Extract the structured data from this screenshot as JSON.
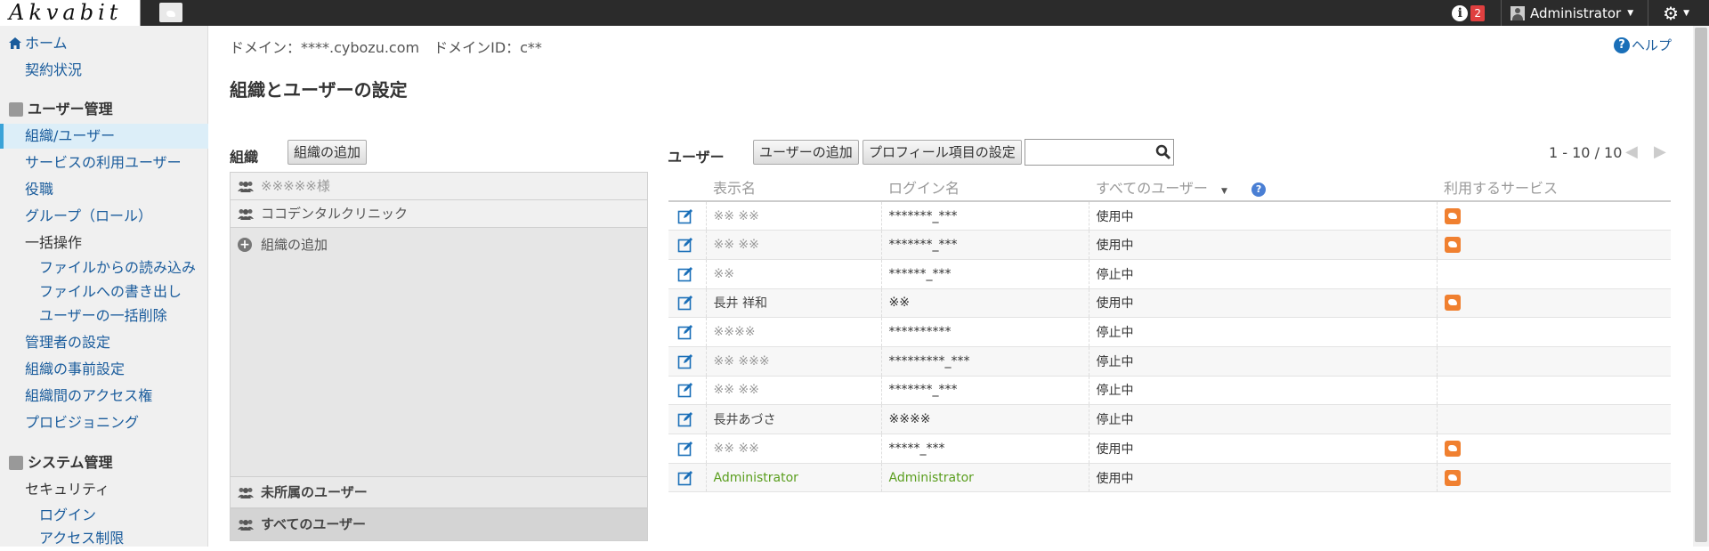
{
  "topbar": {
    "logo_text": "Akvabit",
    "notification_count": "2",
    "user_name": "Administrator"
  },
  "sidebar": {
    "home": "ホーム",
    "contract": "契約状況",
    "user_mgmt_head": "ユーザー管理",
    "items": [
      {
        "label": "組織/ユーザー"
      },
      {
        "label": "サービスの利用ユーザー"
      },
      {
        "label": "役職"
      },
      {
        "label": "グループ（ロール）"
      }
    ],
    "bulk": "一括操作",
    "bulk_items": [
      {
        "label": "ファイルからの読み込み"
      },
      {
        "label": "ファイルへの書き出し"
      },
      {
        "label": "ユーザーの一括削除"
      }
    ],
    "more_items": [
      {
        "label": "管理者の設定"
      },
      {
        "label": "組織の事前設定"
      },
      {
        "label": "組織間のアクセス権"
      },
      {
        "label": "プロビジョニング"
      }
    ],
    "system_head": "システム管理",
    "security": "セキュリティ",
    "security_items": [
      {
        "label": "ログイン"
      },
      {
        "label": "アクセス制限"
      }
    ]
  },
  "header": {
    "domain_text": "ドメイン：****.cybozu.com　ドメインID：c**",
    "help": "ヘルプ",
    "title": "組織とユーザーの設定"
  },
  "org": {
    "label": "組織",
    "add_button": "組織の追加",
    "items": [
      {
        "label": "※※※※※様"
      },
      {
        "label": "ココデンタルクリニック"
      }
    ],
    "add_row": "組織の追加",
    "unassigned": "未所属のユーザー",
    "all_users": "すべてのユーザー"
  },
  "users": {
    "label": "ユーザー",
    "add_button": "ユーザーの追加",
    "profile_button": "プロフィール項目の設定",
    "search_value": "",
    "pager": "1 - 10 / 10",
    "columns": {
      "name": "表示名",
      "login": "ログイン名",
      "filter": "すべてのユーザー",
      "services": "利用するサービス"
    },
    "rows": [
      {
        "name": "※※ ※※",
        "login": "*******_***",
        "status": "使用中",
        "service": true
      },
      {
        "name": "※※ ※※",
        "login": "*******_***",
        "status": "使用中",
        "service": true
      },
      {
        "name": "※※",
        "login": "******_***",
        "status": "停止中",
        "service": false
      },
      {
        "name": "長井 祥和",
        "login": "※※",
        "status": "使用中",
        "service": true
      },
      {
        "name": "※※※※",
        "login": "**********",
        "status": "停止中",
        "service": false
      },
      {
        "name": "※※ ※※※",
        "login": "*********_***",
        "status": "停止中",
        "service": false
      },
      {
        "name": "※※ ※※",
        "login": "*******_***",
        "status": "停止中",
        "service": false
      },
      {
        "name": "長井あづさ",
        "login": "※※※※",
        "status": "停止中",
        "service": false
      },
      {
        "name": "※※ ※※",
        "login": "*****_***",
        "status": "使用中",
        "service": true
      },
      {
        "name": "Administrator",
        "login": "Administrator",
        "status": "使用中",
        "service": true
      }
    ]
  },
  "colors": {
    "accent": "#1a5c9c",
    "active_bg": "#dceef8",
    "service_orange": "#f08030",
    "admin_green": "#5a9e1e",
    "badge_red": "#e04040"
  }
}
